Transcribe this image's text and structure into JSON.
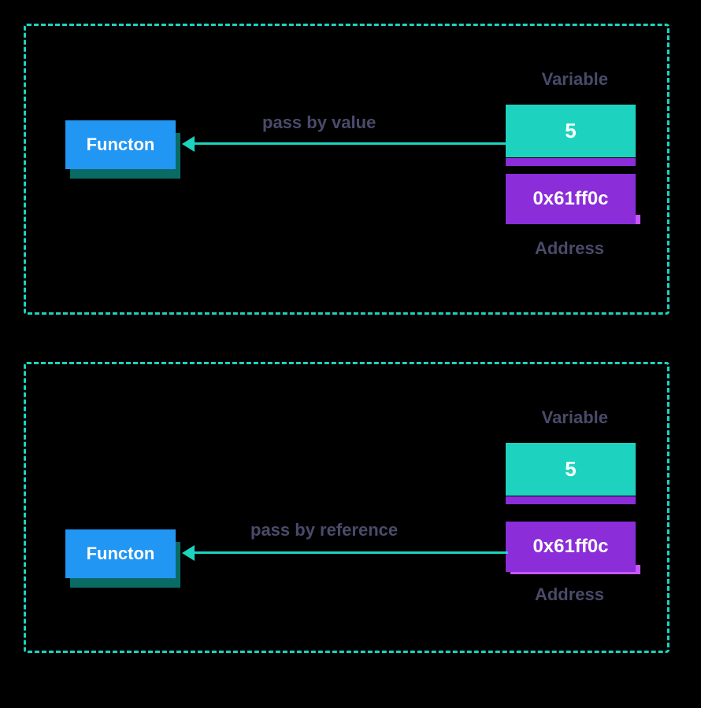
{
  "colors": {
    "border": "#1dd3c0",
    "functionBox": "#2196f3",
    "functionShadow": "#0a6b64",
    "valueBox": "#1dd3c0",
    "addressBox": "#8b2dd8",
    "addressShadow": "#c956ff",
    "text": "#4a4a6a",
    "background": "#000000"
  },
  "panel1": {
    "functionLabel": "Functon",
    "variableLabel": "Variable",
    "value": "5",
    "address": "0x61ff0c",
    "addressLabel": "Address",
    "arrowLabel": "pass by value"
  },
  "panel2": {
    "functionLabel": "Functon",
    "variableLabel": "Variable",
    "value": "5",
    "address": "0x61ff0c",
    "addressLabel": "Address",
    "arrowLabel": "pass by reference"
  }
}
